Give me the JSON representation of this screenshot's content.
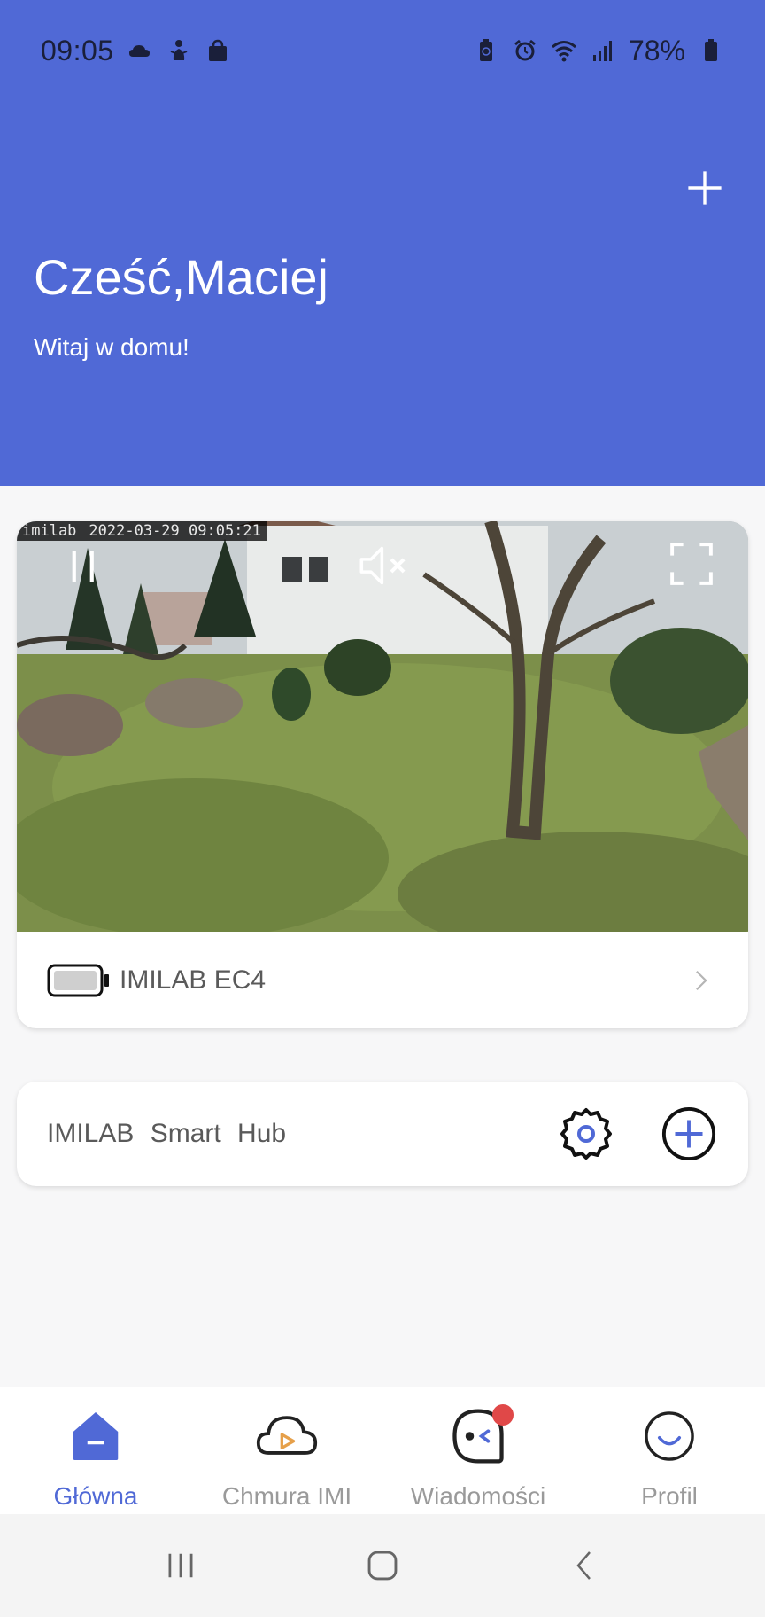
{
  "status_bar": {
    "time": "09:05",
    "battery_text": "78%",
    "left_icons": [
      "cloud-icon",
      "figure-icon",
      "shopping-bag-icon"
    ],
    "right_icons": [
      "battery-saver-icon",
      "alarm-icon",
      "wifi-icon",
      "signal-icon",
      "battery-icon"
    ]
  },
  "header": {
    "greeting": "Cześć,Maciej",
    "subgreeting": "Witaj w domu!",
    "add_icon": "plus-icon",
    "background": "#5069d6"
  },
  "camera": {
    "watermark_brand": "imilab",
    "watermark_timestamp": "2022-03-29  09:05:21",
    "device_name": "IMILAB EC4",
    "controls": [
      "pause-icon",
      "mute-icon",
      "fullscreen-icon"
    ]
  },
  "hub": {
    "name": "IMILAB  Smart  Hub",
    "actions": [
      "gear-icon",
      "plus-circle-icon"
    ]
  },
  "bottom_nav": {
    "items": [
      {
        "label": "Główna",
        "icon": "home-icon",
        "active": true
      },
      {
        "label": "Chmura IMI",
        "icon": "cloud-play-icon",
        "active": false
      },
      {
        "label": "Wiadomości",
        "icon": "message-icon",
        "active": false,
        "badge": true
      },
      {
        "label": "Profil",
        "icon": "smile-icon",
        "active": false
      }
    ],
    "accent": "#5069d6",
    "badge_color": "#e04848"
  },
  "system_nav": [
    "recents-icon",
    "home-button-icon",
    "back-icon"
  ]
}
